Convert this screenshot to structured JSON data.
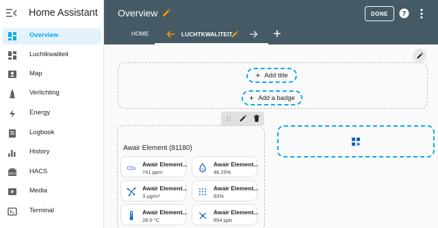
{
  "app": {
    "title": "Home Assistant"
  },
  "sidebar": {
    "items": [
      {
        "label": "Overview",
        "icon": "dashboard-icon",
        "active": true
      },
      {
        "label": "Luchtkwaliteit",
        "icon": "dashboard-icon",
        "active": false
      },
      {
        "label": "Map",
        "icon": "map-pin-icon",
        "active": false
      },
      {
        "label": "Verlichting",
        "icon": "lighthouse-icon",
        "active": false
      },
      {
        "label": "Energy",
        "icon": "lightning-icon",
        "active": false
      },
      {
        "label": "Logbook",
        "icon": "logbook-icon",
        "active": false
      },
      {
        "label": "History",
        "icon": "history-chart-icon",
        "active": false
      },
      {
        "label": "HACS",
        "icon": "hacs-icon",
        "active": false
      },
      {
        "label": "Media",
        "icon": "media-play-icon",
        "active": false
      },
      {
        "label": "Terminal",
        "icon": "terminal-icon",
        "active": false
      }
    ]
  },
  "header": {
    "title": "Overview",
    "done_label": "DONE",
    "tabs": [
      {
        "label": "HOME"
      },
      {
        "label": "LUCHTKWALITEIT"
      }
    ]
  },
  "main": {
    "add_title_label": "Add title",
    "add_badge_label": "Add a badge",
    "card": {
      "title": "Awair Element (81180)",
      "tiles": [
        {
          "name": "Awair Element...",
          "value": "741 ppm",
          "icon": "co2-icon"
        },
        {
          "name": "Awair Element...",
          "value": "46.25%",
          "icon": "water-drop-icon"
        },
        {
          "name": "Awair Element...",
          "value": "3 µg/m³",
          "icon": "particles-icon"
        },
        {
          "name": "Awair Element...",
          "value": "83%",
          "icon": "dots-grid-icon"
        },
        {
          "name": "Awair Element...",
          "value": "28.0 °C",
          "icon": "thermometer-icon"
        },
        {
          "name": "Awair Element...",
          "value": "854 ppb",
          "icon": "chemical-icon"
        }
      ]
    }
  },
  "colors": {
    "header_bg": "#455a64",
    "accent": "#03a9f4",
    "active_bg": "#e3f2fd",
    "edit_orange": "#ff9800"
  }
}
